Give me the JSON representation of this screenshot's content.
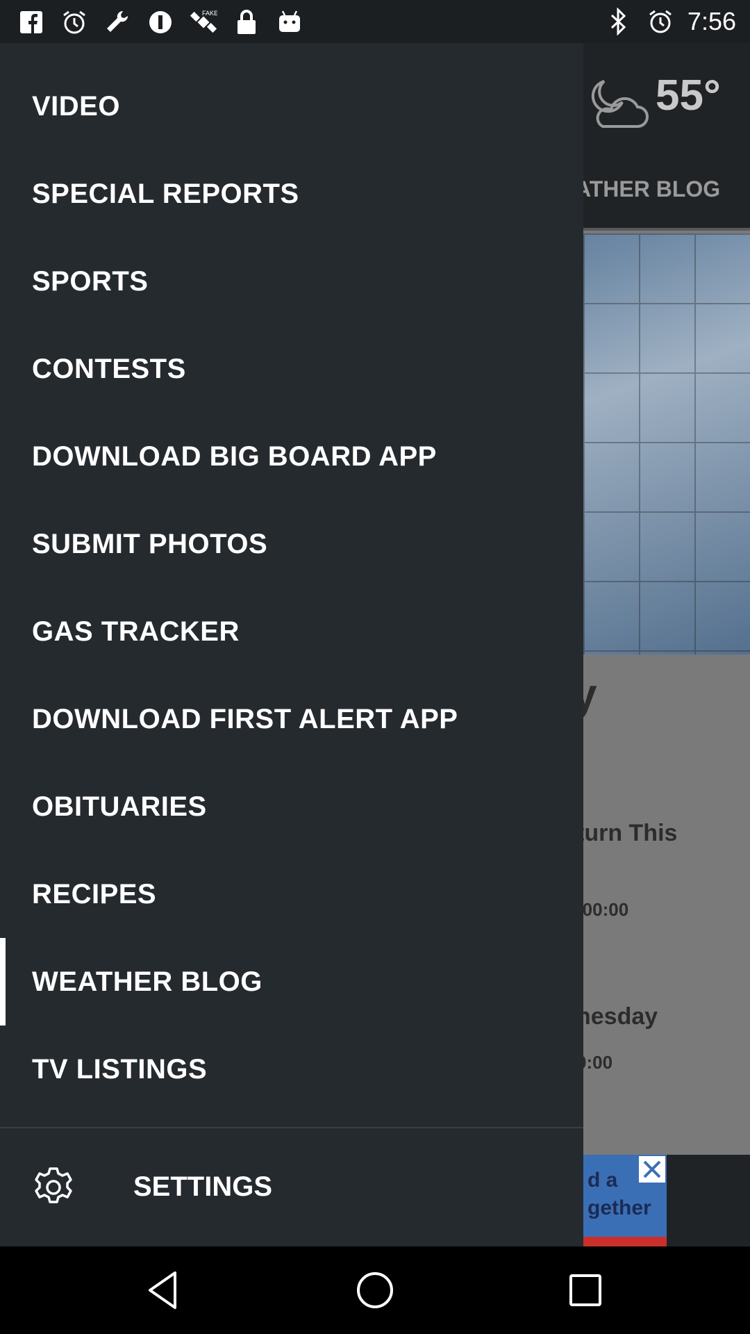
{
  "status_bar": {
    "time": "7:56",
    "left_icons": [
      "facebook-icon",
      "alarm-icon",
      "wrench-icon",
      "info-circle-icon",
      "satellite-icon",
      "lock-icon",
      "android-icon"
    ],
    "right_icons": [
      "bluetooth-icon",
      "alarm-icon"
    ]
  },
  "background_app": {
    "temperature": "55°",
    "tab_label": "ATHER BLOG",
    "headline_fragment": "y",
    "article1_fragment": "turn This",
    "article1_time": "-00:00",
    "article2_fragment": "nesday",
    "article2_time": "0:00",
    "ad_line1": "d a",
    "ad_line2": "gether"
  },
  "drawer": {
    "items": [
      {
        "label": "VIDEO"
      },
      {
        "label": "SPECIAL REPORTS"
      },
      {
        "label": "SPORTS"
      },
      {
        "label": "CONTESTS"
      },
      {
        "label": "DOWNLOAD BIG BOARD APP"
      },
      {
        "label": "SUBMIT PHOTOS"
      },
      {
        "label": "GAS TRACKER"
      },
      {
        "label": "DOWNLOAD FIRST ALERT APP"
      },
      {
        "label": "OBITUARIES"
      },
      {
        "label": "RECIPES"
      },
      {
        "label": "WEATHER BLOG",
        "active": true
      },
      {
        "label": "TV LISTINGS"
      }
    ],
    "settings_label": "SETTINGS"
  },
  "nav_bar": {
    "buttons": [
      "back-icon",
      "home-icon",
      "recents-icon"
    ]
  }
}
